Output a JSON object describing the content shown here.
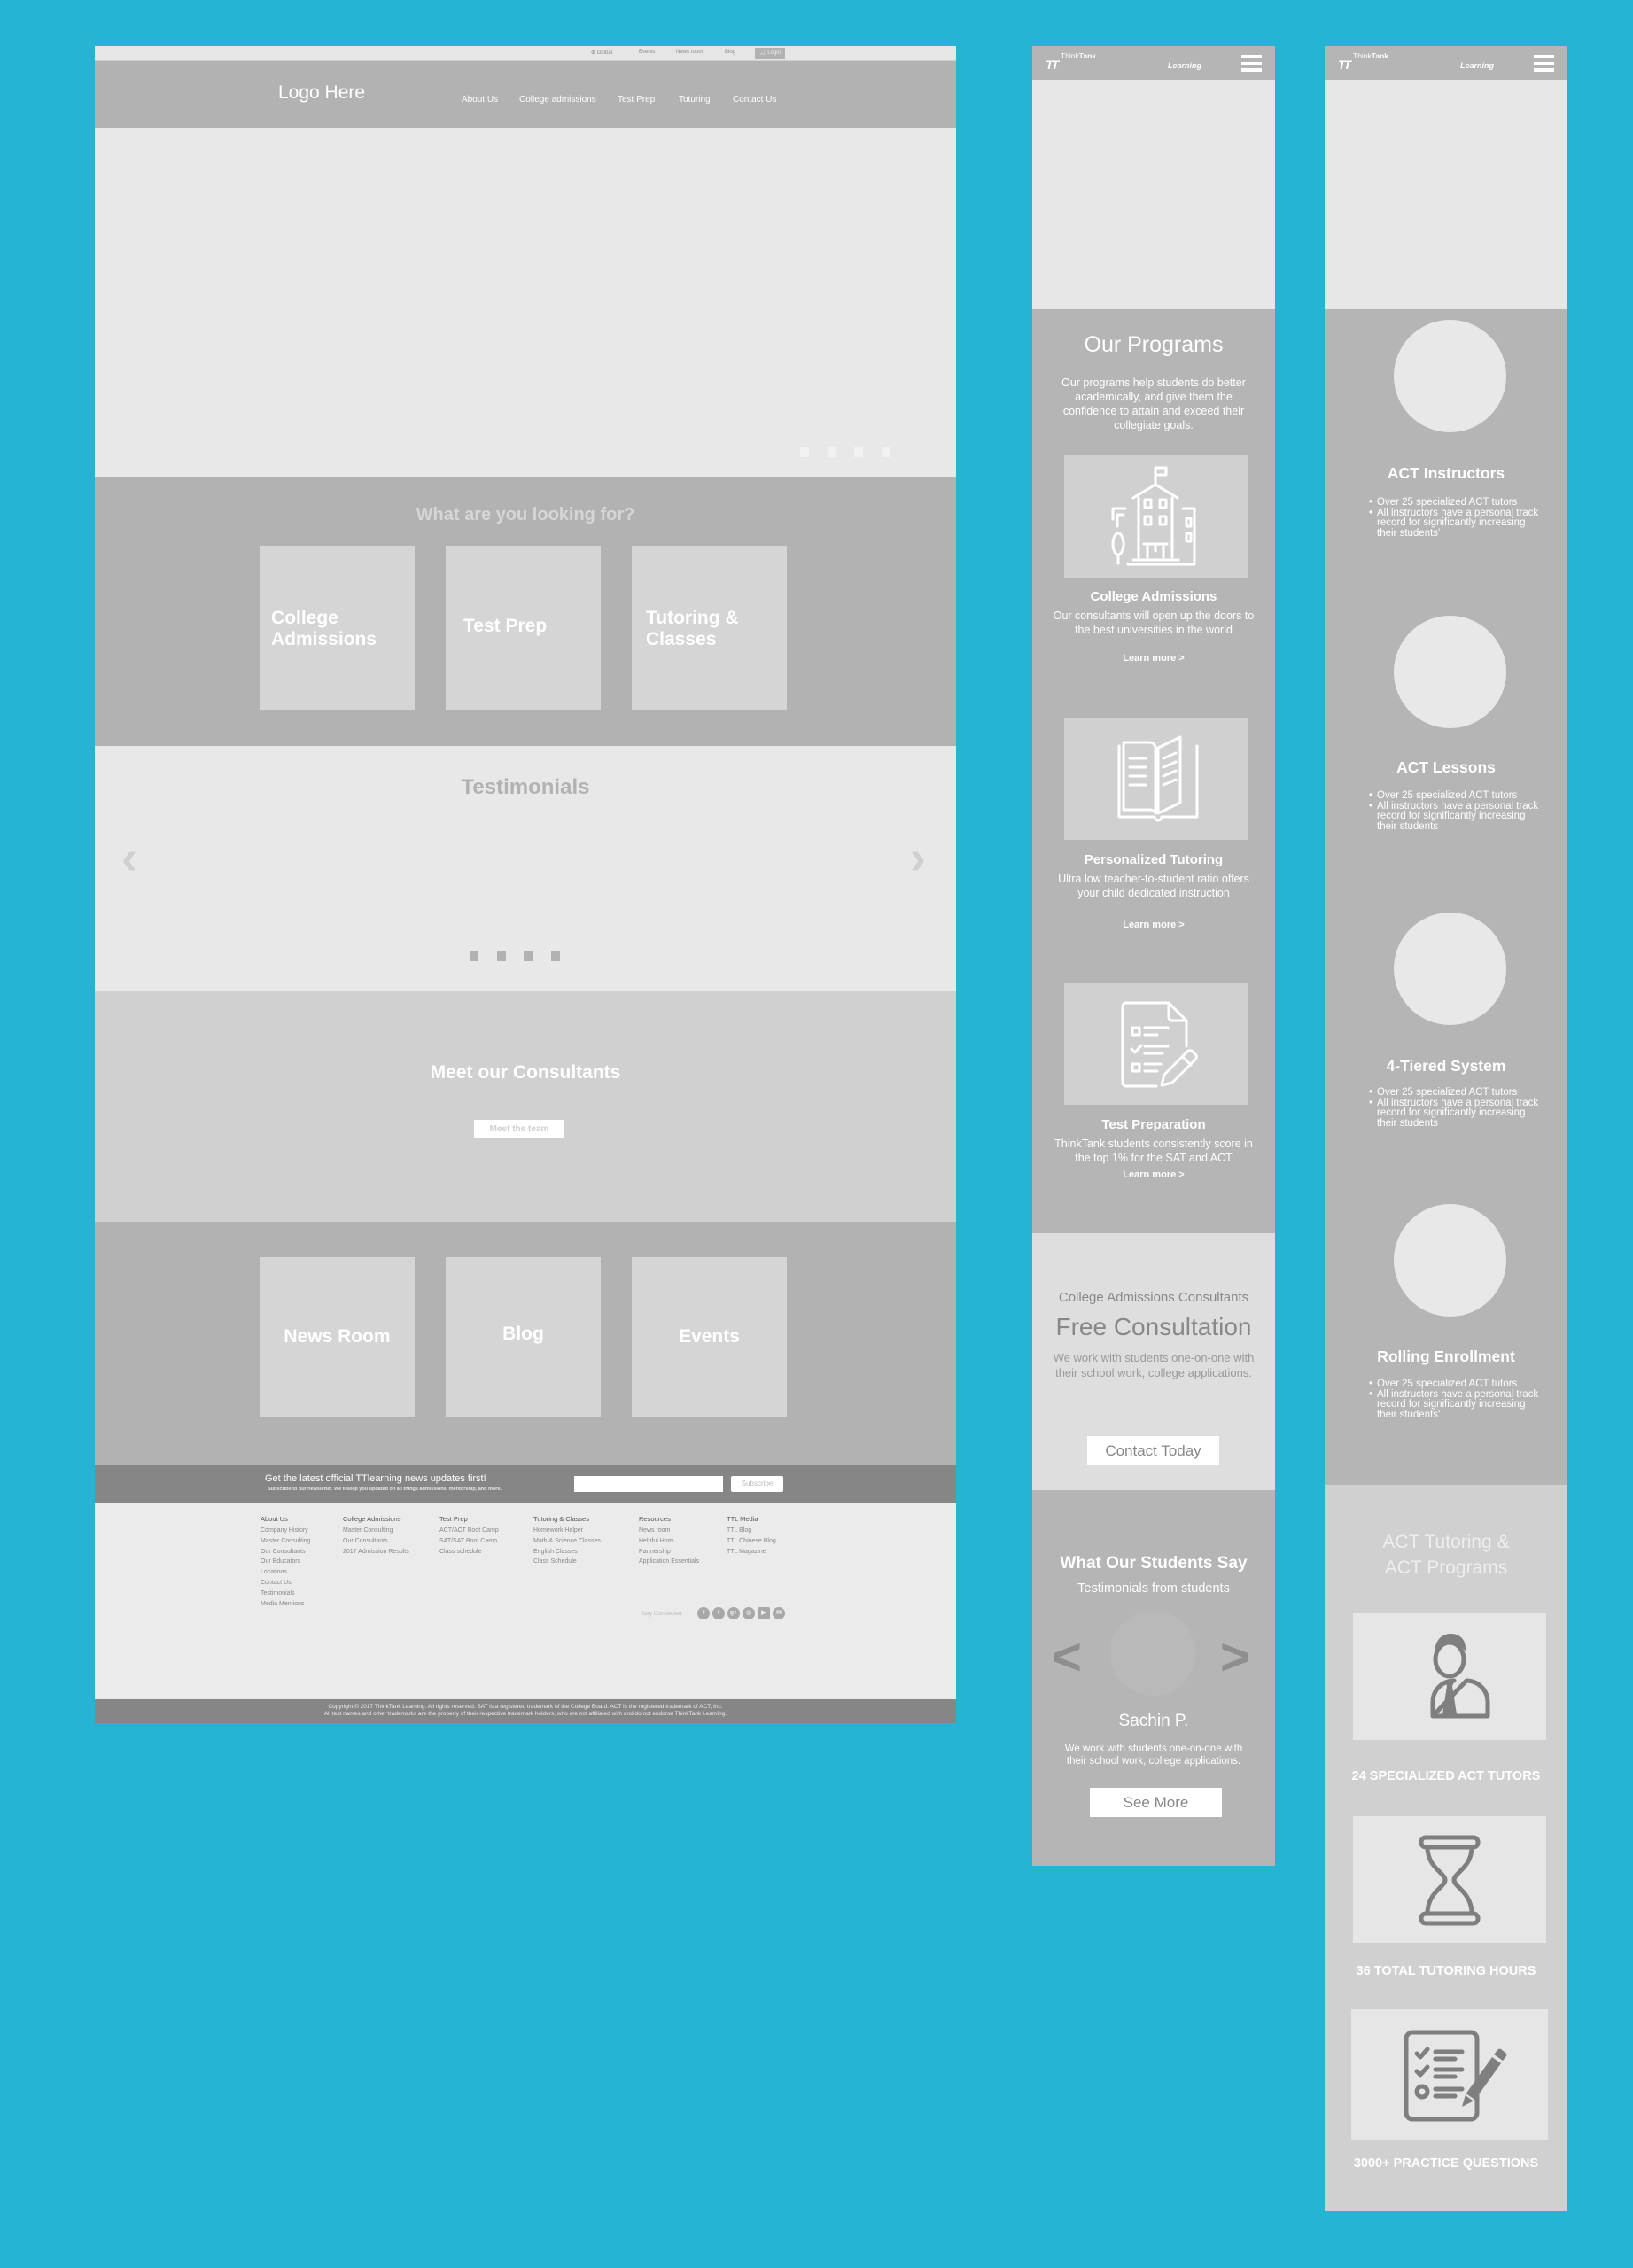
{
  "desktop": {
    "util_nav": {
      "items": [
        "Global",
        "Events",
        "News room",
        "Blog"
      ],
      "login": "Login"
    },
    "logo": "Logo Here",
    "main_nav": [
      "About Us",
      "College admissions",
      "Test Prep",
      "Toturing",
      "Contact Us"
    ],
    "hero": {
      "slide_count": 4
    },
    "looking": {
      "title": "What are you looking for?",
      "cards": [
        "College Admissions",
        "Test Prep",
        "Tutoring & Classes"
      ]
    },
    "testimonials": {
      "title": "Testimonials",
      "prev_icon": "chevron-left",
      "next_icon": "chevron-right",
      "slide_count": 4
    },
    "consultants": {
      "title": "Meet our Consultants",
      "button": "Meet the team"
    },
    "link_cards": [
      "News Room",
      "Blog",
      "Events"
    ],
    "newsletter": {
      "title": "Get the latest official TTlearning news updates first!",
      "subtitle": "Subscribe to our newsletter. We'll keep you updated on all things admissions, mentorship, and more.",
      "email_value": "",
      "button": "Subscribe"
    },
    "footer": {
      "columns": [
        {
          "heading": "About Us",
          "links": [
            "Company History",
            "Master Consulting",
            "Our Consultants",
            "Our Educators",
            "Locations",
            "Contact Us",
            "Testimonials",
            "Media Mentions"
          ]
        },
        {
          "heading": "College Admissions",
          "links": [
            "Master Consulting",
            "Our Consultants",
            "2017 Admission Results"
          ]
        },
        {
          "heading": "Test Prep",
          "links": [
            "ACT/ACT Boot Camp",
            "SAT/SAT Boot Camp",
            "Class schedule"
          ]
        },
        {
          "heading": "Tutoring & Classes",
          "links": [
            "Homework Helper",
            "Math & Science Classes",
            "English Classes",
            "Class Schedule"
          ]
        },
        {
          "heading": "Resources",
          "links": [
            "News room",
            "Helpful Hints",
            "Partnership",
            "Application Essentials"
          ]
        },
        {
          "heading": "TTL Media",
          "links": [
            "TTL Blog",
            "TTL Chinese Blog",
            "TTL Magazine"
          ]
        }
      ],
      "stay_connected": "Stay Connected:",
      "social": [
        {
          "name": "facebook",
          "glyph": "f"
        },
        {
          "name": "twitter",
          "glyph": "t"
        },
        {
          "name": "google-plus",
          "glyph": "g+"
        },
        {
          "name": "instagram",
          "glyph": "◎"
        },
        {
          "name": "youtube",
          "glyph": "▶"
        },
        {
          "name": "email",
          "glyph": "✉"
        }
      ],
      "copyright_line1": "Copyright © 2017 ThinkTank Learning. All rights reserved. SAT is a registered trademark of the College Board. ACT is the registered trademark of ACT, Inc.",
      "copyright_line2": "All test names and other trademarks are the property of their respective trademark holders, who are not affiliated with and do not endorse ThinkTank Learning."
    }
  },
  "mobile_brand": {
    "think": "Think",
    "tank": "Tank",
    "learning": "Learning",
    "mark": "TT"
  },
  "mobile1": {
    "programs": {
      "title": "Our Programs",
      "intro": "Our programs help students do better academically, and give them the confidence to attain and exceed their collegiate goals.",
      "items": [
        {
          "icon": "school-building",
          "title": "College Admissions",
          "desc": "Our consultants will open up the doors to the best universities in the world",
          "link": "Learn more >"
        },
        {
          "icon": "open-book",
          "title": "Personalized Tutoring",
          "desc": "Ultra low teacher-to-student ratio offers your child dedicated instruction",
          "link": "Learn more >"
        },
        {
          "icon": "checklist-document",
          "title": "Test Preparation",
          "desc": "ThinkTank students consistently score in the top 1% for the SAT and ACT",
          "link": "Learn more >"
        }
      ]
    },
    "consultation": {
      "kicker": "College Admissions Consultants",
      "title": "Free Consultation",
      "desc": "We work with students one-on-one with their school work, college applications.",
      "button": "Contact Today"
    },
    "students_say": {
      "title": "What Our Students Say",
      "subtitle": "Testimonials from students",
      "name": "Sachin P.",
      "desc": "We work with students one-on-one with their school work, college applications.",
      "button": "See More"
    }
  },
  "mobile2": {
    "features": [
      {
        "title": "ACT Instructors",
        "bullets": [
          "Over 25 specialized ACT tutors",
          "All instructors have a personal track record for significantly increasing their students'"
        ]
      },
      {
        "title": "ACT Lessons",
        "bullets": [
          "Over 25 specialized ACT tutors",
          "All instructors have a personal track record for significantly increasing their students"
        ]
      },
      {
        "title": "4-Tiered System",
        "bullets": [
          "Over 25 specialized ACT tutors",
          "All instructors have a personal track record for significantly increasing their students"
        ]
      },
      {
        "title": "Rolling Enrollment",
        "bullets": [
          "Over 25 specialized ACT tutors",
          "All instructors have a personal track record for significantly increasing their students'"
        ]
      }
    ],
    "stats": {
      "title_line1": "ACT Tutoring &",
      "title_line2": "ACT Programs",
      "items": [
        {
          "icon": "tutor-person",
          "label": "24 SPECIALIZED ACT TUTORS"
        },
        {
          "icon": "hourglass",
          "label": "36 TOTAL TUTORING HOURS"
        },
        {
          "icon": "checklist-pencil",
          "label": "3000+ PRACTICE QUESTIONS"
        }
      ]
    }
  }
}
